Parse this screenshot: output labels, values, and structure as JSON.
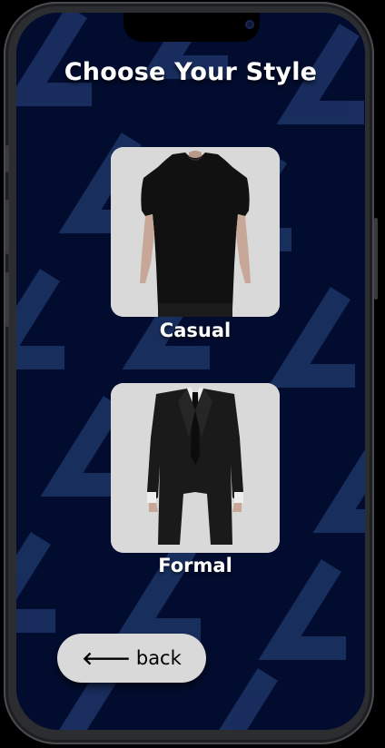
{
  "screen": {
    "title": "Choose Your Style"
  },
  "styles": [
    {
      "label": "Casual",
      "icon": "black-tshirt-photo"
    },
    {
      "label": "Formal",
      "icon": "black-suit-photo"
    }
  ],
  "back_button": {
    "icon": "arrow-left-icon",
    "arrow": "🡐",
    "label": "back"
  },
  "colors": {
    "background": "#020c2f",
    "pattern": "#1d3466",
    "card": "#d9d9d9",
    "text": "#ffffff"
  }
}
